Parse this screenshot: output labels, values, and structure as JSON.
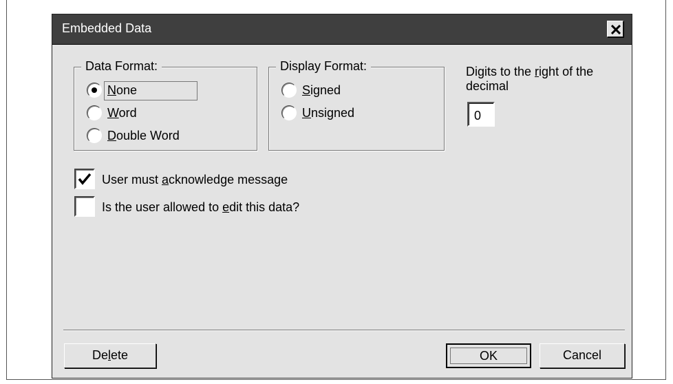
{
  "dialog": {
    "title": "Embedded Data",
    "close_glyph": "X"
  },
  "data_format": {
    "legend": "Data Format:",
    "options": [
      {
        "label": "None",
        "mnemonic_index": 0,
        "selected": true
      },
      {
        "label": "Word",
        "mnemonic_index": 0,
        "selected": false
      },
      {
        "label": "Double Word",
        "mnemonic_index": 0,
        "selected": false
      }
    ]
  },
  "display_format": {
    "legend": "Display Format:",
    "options": [
      {
        "label": "Signed",
        "mnemonic_index": 0,
        "selected": false
      },
      {
        "label": "Unsigned",
        "mnemonic_index": 0,
        "selected": false
      }
    ]
  },
  "digits": {
    "label_pre": "Digits to the ",
    "label_mnemonic": "r",
    "label_post": "ight of the decimal",
    "value": "0"
  },
  "checkboxes": {
    "acknowledge": {
      "pre": "User must ",
      "mnemonic": "a",
      "post": "cknowledge message",
      "checked": true
    },
    "edit": {
      "pre": "Is the user allowed to ",
      "mnemonic": "e",
      "post": "dit this data?",
      "checked": false
    }
  },
  "buttons": {
    "delete": {
      "pre": "De",
      "mnemonic": "l",
      "post": "ete"
    },
    "ok": "OK",
    "cancel": "Cancel"
  }
}
